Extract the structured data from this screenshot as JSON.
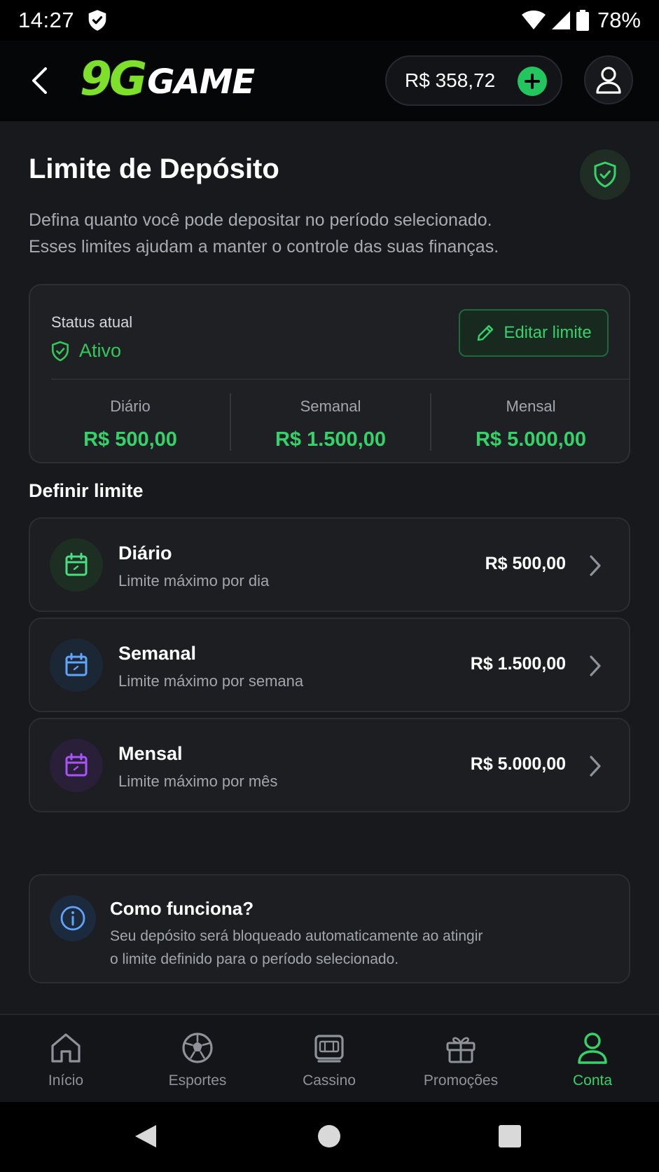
{
  "status_bar": {
    "time": "14:27",
    "battery": "78%"
  },
  "header": {
    "balance": "R$ 358,72",
    "logo_primary": "9G",
    "logo_secondary": "GAME"
  },
  "page": {
    "title": "Limite de Depósito",
    "description_line1": "Defina quanto você pode depositar no período selecionado.",
    "description_line2": "Esses limites ajudam a manter o controle das suas finanças."
  },
  "status_card": {
    "label": "Status atual",
    "value": "Ativo",
    "edit_label": "Editar limite",
    "columns": [
      {
        "label": "Diário",
        "value": "R$ 500,00"
      },
      {
        "label": "Semanal",
        "value": "R$ 1.500,00"
      },
      {
        "label": "Mensal",
        "value": "R$ 5.000,00"
      }
    ]
  },
  "define_section": {
    "title": "Definir limite",
    "rows": [
      {
        "title": "Diário",
        "subtitle": "Limite máximo por dia",
        "amount": "R$ 500,00",
        "icon": "calendar-icon",
        "color": "#4ade80"
      },
      {
        "title": "Semanal",
        "subtitle": "Limite máximo por semana",
        "amount": "R$ 1.500,00",
        "icon": "calendar-icon",
        "color": "#60a5fa"
      },
      {
        "title": "Mensal",
        "subtitle": "Limite máximo por mês",
        "amount": "R$ 5.000,00",
        "icon": "calendar-icon",
        "color": "#a855f7"
      }
    ]
  },
  "info": {
    "title": "Como funciona?",
    "line1": "Seu depósito será bloqueado automaticamente ao atingir",
    "line2": "o limite definido para o período selecionado."
  },
  "bottom_nav": {
    "items": [
      {
        "label": "Início",
        "icon": "home-icon",
        "active": false
      },
      {
        "label": "Esportes",
        "icon": "soccer-ball-icon",
        "active": false
      },
      {
        "label": "Cassino",
        "icon": "slot-machine-icon",
        "active": false
      },
      {
        "label": "Promoções",
        "icon": "gift-icon",
        "active": false
      },
      {
        "label": "Conta",
        "icon": "user-icon",
        "active": true
      }
    ]
  },
  "colors": {
    "accent": "#34d36a",
    "background": "#18191c",
    "card": "#1e2024"
  }
}
